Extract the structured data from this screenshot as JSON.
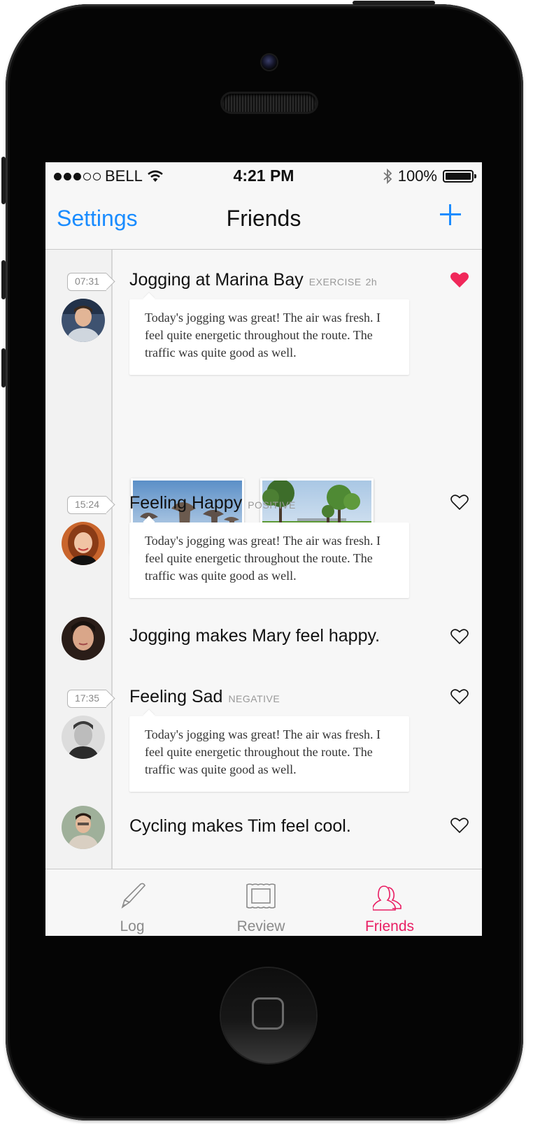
{
  "status_bar": {
    "carrier": "BELL",
    "signal_bars": 3,
    "time": "4:21 PM",
    "battery": "100%"
  },
  "nav": {
    "left_label": "Settings",
    "title": "Friends",
    "right_icon": "plus-icon"
  },
  "posts": [
    {
      "time_tag": "07:31",
      "title": "Jogging at Marina Bay",
      "category": "EXERCISE",
      "age": "2h",
      "liked": true,
      "body": "Today's jogging was great! The air was fresh. I feel quite energetic throughout the route. The traffic was quite good as well."
    },
    {
      "time_tag": "15:24",
      "title": "Feeling Happy",
      "category": "POSITIVE",
      "liked": false,
      "body": "Today's jogging was great! The air was fresh. I feel quite energetic throughout the route. The traffic was quite good as well."
    },
    {
      "sentence": "Jogging makes Mary feel happy.",
      "liked": false
    },
    {
      "time_tag": "17:35",
      "title": "Feeling Sad",
      "category": "NEGATIVE",
      "liked": false,
      "body": "Today's jogging was great! The air was fresh. I feel quite energetic throughout the route. The traffic was quite good as well."
    },
    {
      "sentence": "Cycling makes Tim feel cool.",
      "liked": false
    }
  ],
  "tabs": [
    {
      "label": "Log",
      "icon": "pen-icon",
      "active": false
    },
    {
      "label": "Review",
      "icon": "picture-frame-icon",
      "active": false
    },
    {
      "label": "Friends",
      "icon": "friends-icon",
      "active": true
    }
  ],
  "colors": {
    "accent_blue": "#1a8cff",
    "accent_pink": "#e91e63",
    "heart_filled": "#f0285a"
  }
}
